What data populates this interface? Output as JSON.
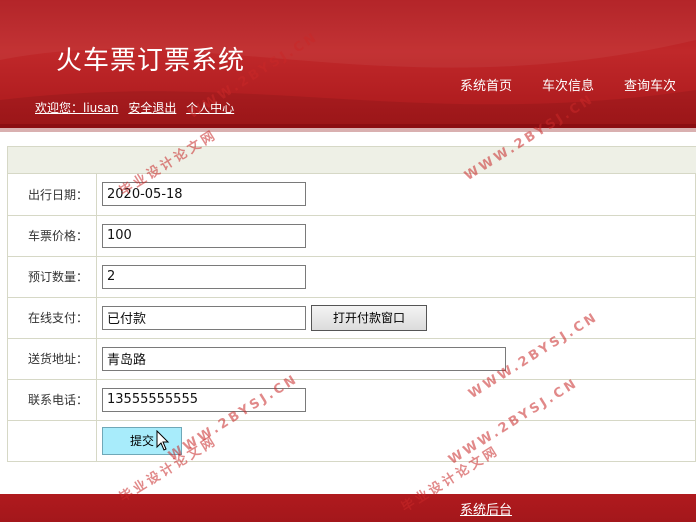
{
  "header": {
    "title": "火车票订票系统",
    "welcome_label": "欢迎您：liusan",
    "logout_link": "安全退出",
    "profile_link": "个人中心",
    "nav": [
      "系统首页",
      "车次信息",
      "查询车次"
    ]
  },
  "form": {
    "fields": [
      {
        "label": "出行日期：",
        "value": "2020-05-18"
      },
      {
        "label": "车票价格：",
        "value": "100"
      },
      {
        "label": "预订数量：",
        "value": "2"
      },
      {
        "label": "在线支付：",
        "value": "已付款",
        "button": "打开付款窗口"
      },
      {
        "label": "送货地址：",
        "value": "青岛路"
      },
      {
        "label": "联系电话：",
        "value": "13555555555"
      }
    ],
    "submit_label": "提交"
  },
  "footer": {
    "admin_link": "系统后台"
  },
  "watermarks": {
    "text_url": "WWW.2BYSJ.CN",
    "text_cn": "毕业设计论文网"
  },
  "colors": {
    "brand_red": "#b01a1e",
    "submit_bg": "#a8ecfb",
    "table_border": "#d6d8c6"
  }
}
